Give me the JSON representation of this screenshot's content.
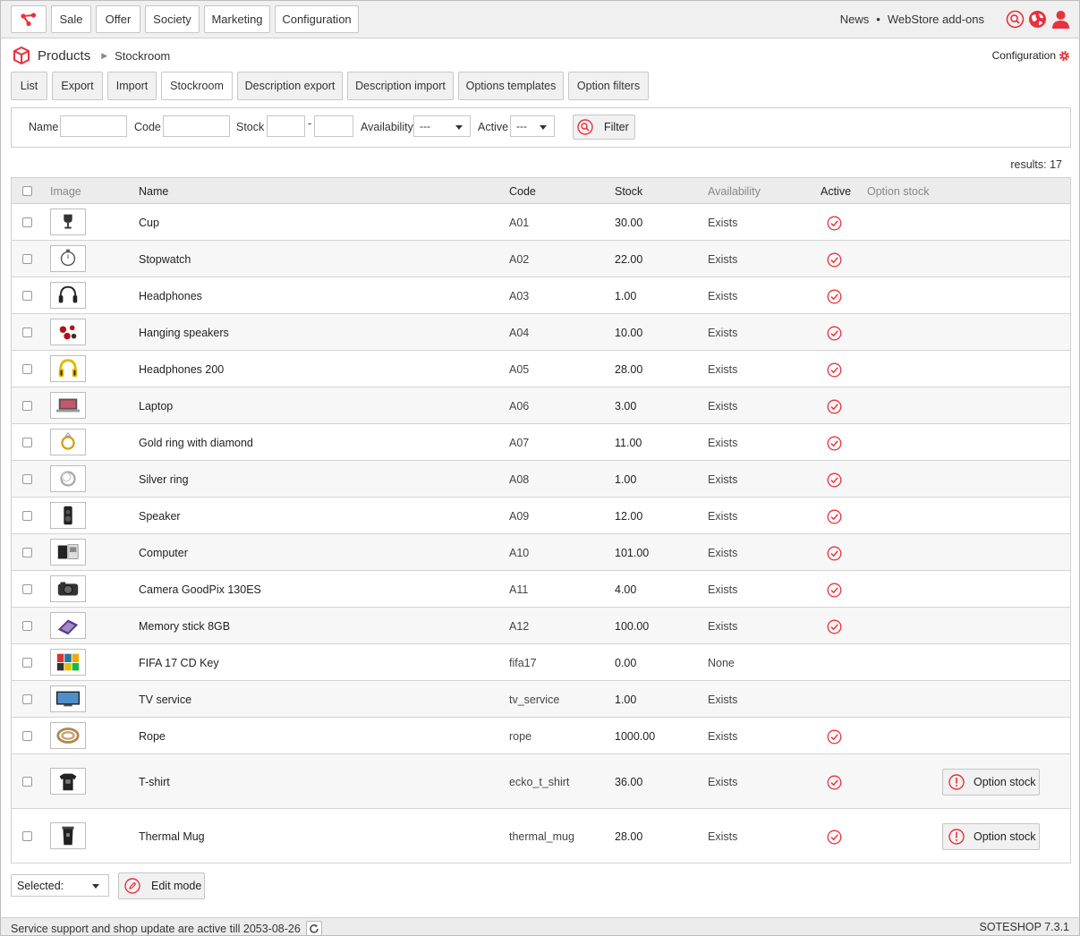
{
  "topbar": {
    "nav": [
      "Sale",
      "Offer",
      "Society",
      "Marketing",
      "Configuration"
    ],
    "links": [
      "News",
      "WebStore add-ons"
    ],
    "separator": "•"
  },
  "breadcrumb": {
    "title": "Products",
    "current": "Stockroom"
  },
  "config_link": "Configuration",
  "tabs": [
    "List",
    "Export",
    "Import",
    "Stockroom",
    "Description export",
    "Description import",
    "Options templates",
    "Option filters"
  ],
  "active_tab": "Stockroom",
  "filter": {
    "name_label": "Name",
    "code_label": "Code",
    "stock_label": "Stock",
    "range_sep": "-",
    "availability_label": "Availability",
    "availability_value": "---",
    "active_label": "Active",
    "active_value": "---",
    "button": "Filter"
  },
  "results": "results: 17",
  "table": {
    "headers": {
      "image": "Image",
      "name": "Name",
      "code": "Code",
      "stock": "Stock",
      "availability": "Availability",
      "active": "Active",
      "option_stock": "Option stock"
    },
    "option_button": "Option stock",
    "rows": [
      {
        "name": "Cup",
        "code": "A01",
        "stock": "30.00",
        "availability": "Exists",
        "active": true,
        "option_stock": false
      },
      {
        "name": "Stopwatch",
        "code": "A02",
        "stock": "22.00",
        "availability": "Exists",
        "active": true,
        "option_stock": false
      },
      {
        "name": "Headphones",
        "code": "A03",
        "stock": "1.00",
        "availability": "Exists",
        "active": true,
        "option_stock": false
      },
      {
        "name": "Hanging speakers",
        "code": "A04",
        "stock": "10.00",
        "availability": "Exists",
        "active": true,
        "option_stock": false
      },
      {
        "name": "Headphones 200",
        "code": "A05",
        "stock": "28.00",
        "availability": "Exists",
        "active": true,
        "option_stock": false
      },
      {
        "name": "Laptop",
        "code": "A06",
        "stock": "3.00",
        "availability": "Exists",
        "active": true,
        "option_stock": false
      },
      {
        "name": "Gold ring with diamond",
        "code": "A07",
        "stock": "11.00",
        "availability": "Exists",
        "active": true,
        "option_stock": false
      },
      {
        "name": "Silver ring",
        "code": "A08",
        "stock": "1.00",
        "availability": "Exists",
        "active": true,
        "option_stock": false
      },
      {
        "name": "Speaker",
        "code": "A09",
        "stock": "12.00",
        "availability": "Exists",
        "active": true,
        "option_stock": false
      },
      {
        "name": "Computer",
        "code": "A10",
        "stock": "101.00",
        "availability": "Exists",
        "active": true,
        "option_stock": false
      },
      {
        "name": "Camera GoodPix 130ES",
        "code": "A11",
        "stock": "4.00",
        "availability": "Exists",
        "active": true,
        "option_stock": false
      },
      {
        "name": "Memory stick 8GB",
        "code": "A12",
        "stock": "100.00",
        "availability": "Exists",
        "active": true,
        "option_stock": false
      },
      {
        "name": "FIFA 17 CD Key",
        "code": "fifa17",
        "stock": "0.00",
        "availability": "None",
        "active": false,
        "option_stock": false
      },
      {
        "name": "TV service",
        "code": "tv_service",
        "stock": "1.00",
        "availability": "Exists",
        "active": false,
        "option_stock": false
      },
      {
        "name": "Rope",
        "code": "rope",
        "stock": "1000.00",
        "availability": "Exists",
        "active": true,
        "option_stock": false
      },
      {
        "name": "T-shirt",
        "code": "ecko_t_shirt",
        "stock": "36.00",
        "availability": "Exists",
        "active": true,
        "option_stock": true
      },
      {
        "name": "Thermal Mug",
        "code": "thermal_mug",
        "stock": "28.00",
        "availability": "Exists",
        "active": true,
        "option_stock": true
      }
    ]
  },
  "bulk": {
    "selected_label": "Selected:",
    "edit_mode": "Edit mode"
  },
  "footer": {
    "support": "Service support and shop update are active till 2053-08-26",
    "version": "SOTESHOP 7.3.1"
  },
  "colors": {
    "accent": "#e8323c",
    "header_bg": "#ececec"
  }
}
